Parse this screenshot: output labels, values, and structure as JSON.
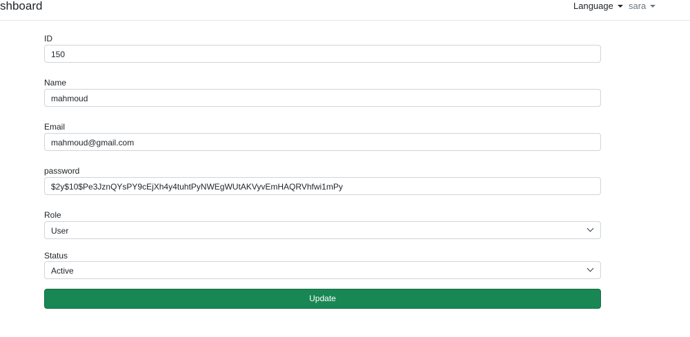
{
  "navbar": {
    "brand": "shboard",
    "language_label": "Language",
    "user_label": "sara"
  },
  "form": {
    "id": {
      "label": "ID",
      "value": "150"
    },
    "name": {
      "label": "Name",
      "value": "mahmoud"
    },
    "email": {
      "label": "Email",
      "value": "mahmoud@gmail.com"
    },
    "password": {
      "label": "password",
      "value": "$2y$10$Pe3JznQYsPY9cEjXh4y4tuhtPyNWEgWUtAKVyvEmHAQRVhfwi1mPy"
    },
    "role": {
      "label": "Role",
      "selected": "User"
    },
    "status": {
      "label": "Status",
      "selected": "Active"
    },
    "submit_label": "Update"
  },
  "colors": {
    "button_bg": "#198754",
    "border": "#ced4da"
  },
  "icons": {
    "dropdown": "caret-down-icon",
    "select": "chevron-down-icon"
  }
}
